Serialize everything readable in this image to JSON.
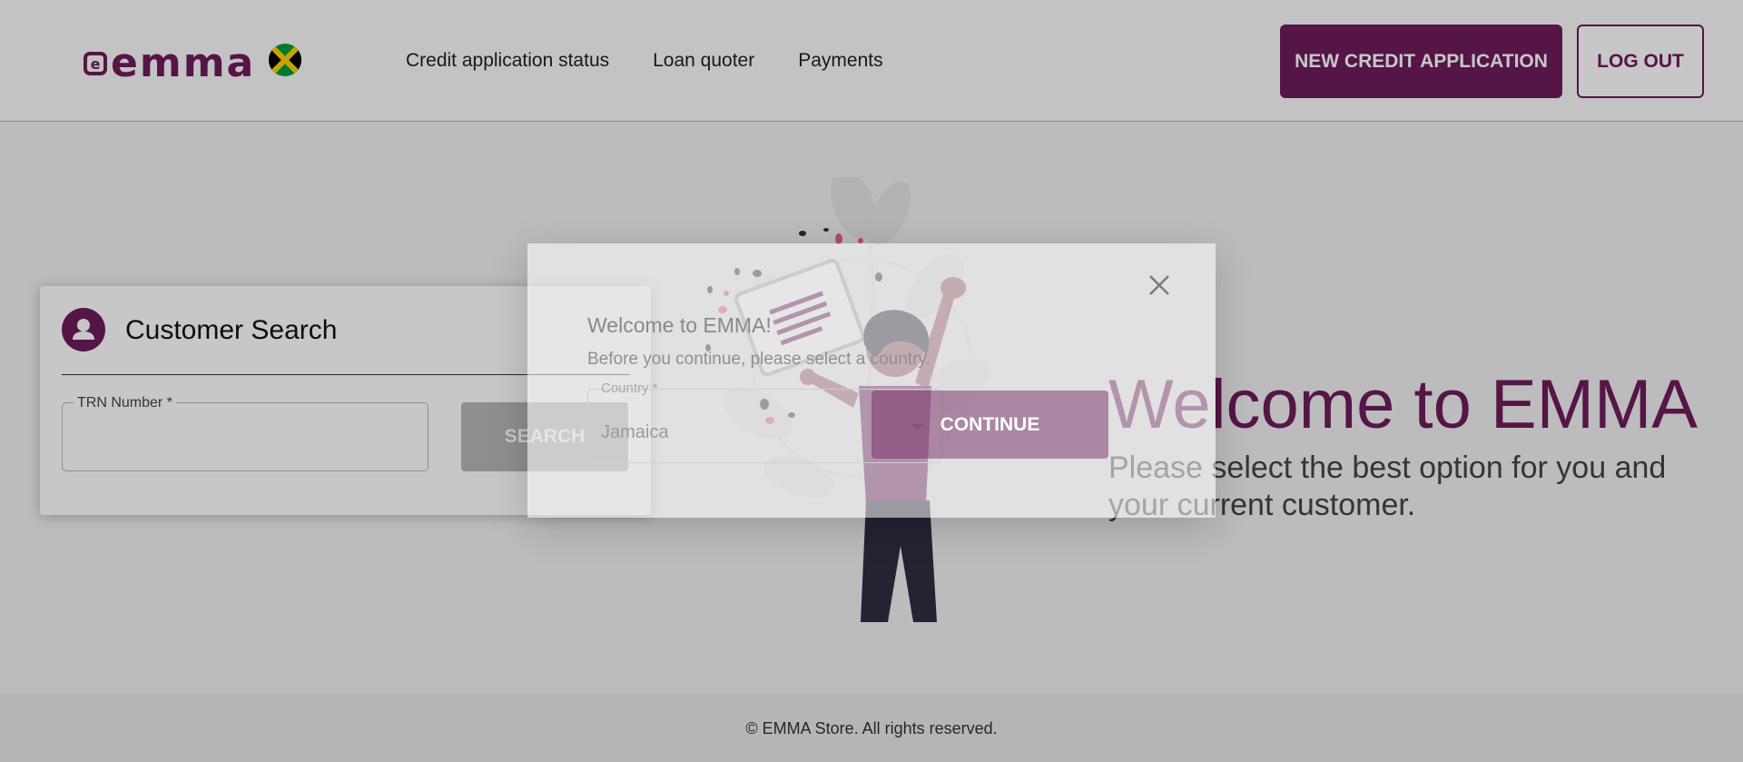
{
  "header": {
    "logo_text": "emma",
    "flag_icon": "jamaica-flag-icon",
    "nav": [
      {
        "label": "Credit application status"
      },
      {
        "label": "Loan quoter"
      },
      {
        "label": "Payments"
      }
    ],
    "new_application_label": "NEW CREDIT APPLICATION",
    "logout_label": "LOG OUT"
  },
  "customer_search": {
    "title": "Customer Search",
    "field_label": "TRN Number *",
    "field_value": "",
    "search_label": "SEARCH"
  },
  "hero": {
    "title": "Welcome to EMMA",
    "subtitle": "Please select the best option for you and your current customer."
  },
  "footer": {
    "text": "© EMMA Store. All rights reserved."
  },
  "dialog": {
    "title": "Welcome to EMMA!",
    "subtitle": "Before you continue, please select a country.",
    "country_label": "Country *",
    "country_value": "Jamaica",
    "continue_label": "CONTINUE"
  },
  "colors": {
    "brand": "#6d1b5b",
    "accent_pink": "#e8637e",
    "dark": "#2f2e41"
  }
}
